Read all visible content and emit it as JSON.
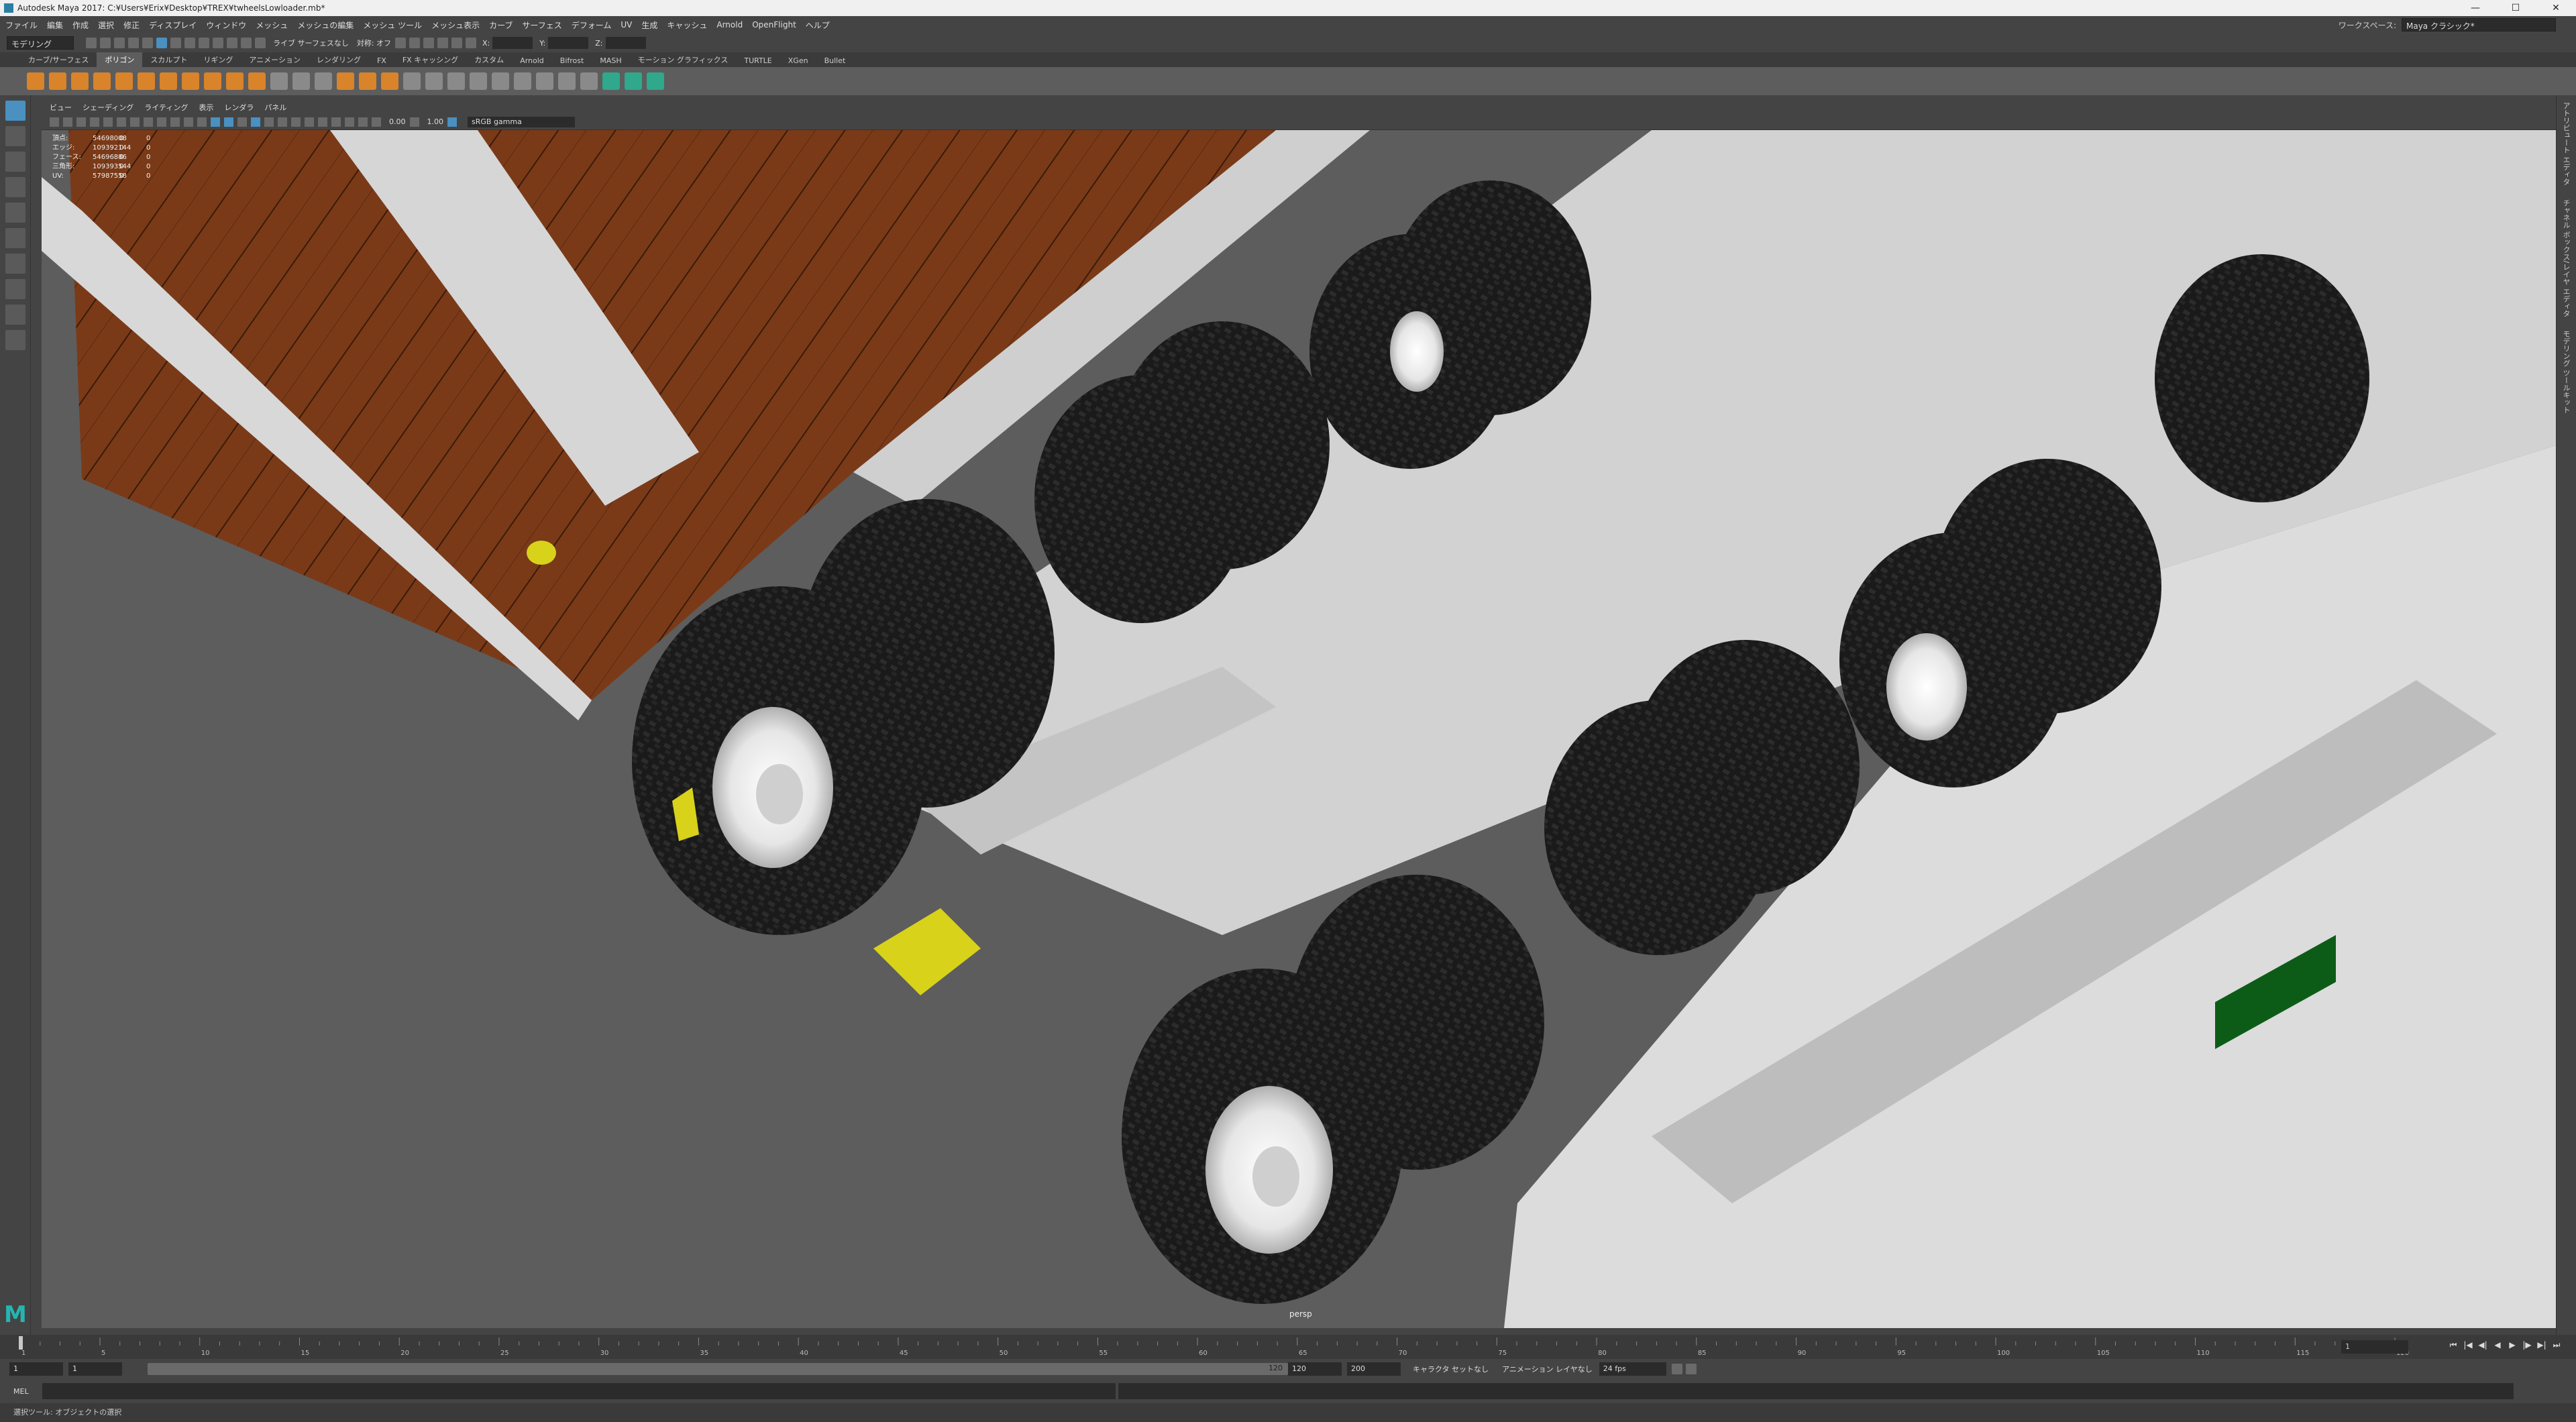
{
  "window": {
    "title": "Autodesk Maya 2017: C:¥Users¥Erix¥Desktop¥TREX¥twheelsLowloader.mb*",
    "controls": [
      "—",
      "☐",
      "✕"
    ]
  },
  "menubar": {
    "items": [
      "ファイル",
      "編集",
      "作成",
      "選択",
      "修正",
      "ディスプレイ",
      "ウィンドウ",
      "メッシュ",
      "メッシュの編集",
      "メッシュ ツール",
      "メッシュ表示",
      "カーブ",
      "サーフェス",
      "デフォーム",
      "UV",
      "生成",
      "キャッシュ",
      "Arnold",
      "OpenFlight",
      "ヘルプ"
    ],
    "workspace_label": "ワークスペース:",
    "workspace_value": "Maya クラシック*"
  },
  "statusline": {
    "menuset": "モデリング",
    "live_label": "ライブ サーフェスなし",
    "symmetry_label": "対称: オフ",
    "x": "X:",
    "y": "Y:",
    "z": "Z:"
  },
  "shelf": {
    "tabs": [
      "カーブ/サーフェス",
      "ポリゴン",
      "スカルプト",
      "リギング",
      "アニメーション",
      "レンダリング",
      "FX",
      "FX キャッシング",
      "カスタム",
      "Arnold",
      "Bifrost",
      "MASH",
      "モーション グラフィックス",
      "TURTLE",
      "XGen",
      "Bullet"
    ],
    "active_tab": "ポリゴン"
  },
  "panel": {
    "menu": [
      "ビュー",
      "シェーディング",
      "ライティング",
      "表示",
      "レンダラ",
      "パネル"
    ],
    "exposure": "0.00",
    "gamma": "1.00",
    "color_space": "sRGB gamma"
  },
  "hud": {
    "rows": [
      {
        "label": "頂点:",
        "a": "54698008",
        "b": "0",
        "c": "0"
      },
      {
        "label": "エッジ:",
        "a": "109392144",
        "b": "0",
        "c": "0"
      },
      {
        "label": "フェース:",
        "a": "54696886",
        "b": "0",
        "c": "0"
      },
      {
        "label": "三角形:",
        "a": "109393544",
        "b": "0",
        "c": "0"
      },
      {
        "label": "UV:",
        "a": "57987558",
        "b": "0",
        "c": "0"
      }
    ],
    "camera": "persp"
  },
  "timeslider": {
    "current_frame": "1",
    "ticks": [
      "1",
      "5",
      "10",
      "15",
      "20",
      "25",
      "30",
      "35",
      "40",
      "45",
      "50",
      "55",
      "60",
      "65",
      "70",
      "75",
      "80",
      "85",
      "90",
      "95",
      "100",
      "105",
      "110",
      "115",
      "120"
    ]
  },
  "rangeslider": {
    "start": "1",
    "start_inner": "1",
    "bar_start": "1",
    "bar_end": "120",
    "end_inner": "120",
    "end": "200",
    "character_set": "キャラクタ セットなし",
    "anim_layer": "アニメーション レイヤなし",
    "fps": "24 fps"
  },
  "cmdline": {
    "label": "MEL"
  },
  "helpline": {
    "text": "選択ツール: オブジェクトの選択"
  },
  "sidetabs": [
    "アトリビュート エディタ",
    "チャネル ボックス/レイヤ エディタ",
    "モデリング ツールキット"
  ]
}
